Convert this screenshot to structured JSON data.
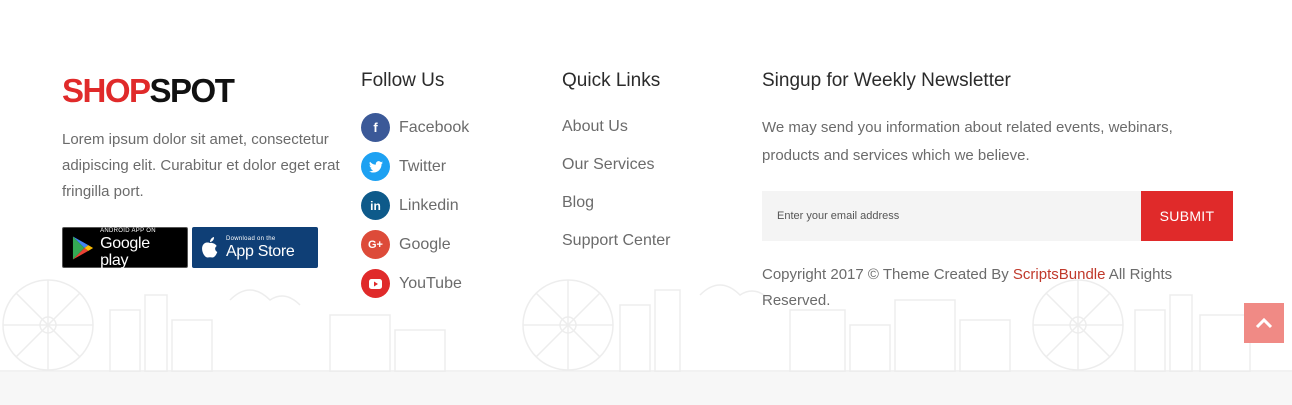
{
  "brand": {
    "logo_part1": "SHOP",
    "logo_part2": "SPOT",
    "about": "Lorem ipsum dolor sit amet, consectetur adipiscing elit. Curabitur et dolor eget erat fringilla port.",
    "stores": [
      {
        "small": "ANDROID APP ON",
        "big": "Google play",
        "icon": "google-play-icon"
      },
      {
        "small": "Download on the",
        "big": "App Store",
        "icon": "apple-icon"
      }
    ]
  },
  "follow": {
    "title": "Follow Us",
    "items": [
      {
        "label": "Facebook",
        "icon": "facebook-icon",
        "glyph": "f",
        "color": "#3b5998"
      },
      {
        "label": "Twitter",
        "icon": "twitter-icon",
        "glyph": "t",
        "color": "#1da1f2"
      },
      {
        "label": "Linkedin",
        "icon": "linkedin-icon",
        "glyph": "in",
        "color": "#0e5a8a"
      },
      {
        "label": "Google",
        "icon": "google-plus-icon",
        "glyph": "G+",
        "color": "#dd4b39"
      },
      {
        "label": "YouTube",
        "icon": "youtube-icon",
        "glyph": "▶",
        "color": "#e02a2a"
      }
    ]
  },
  "quick_links": {
    "title": "Quick Links",
    "items": [
      "About Us",
      "Our Services",
      "Blog",
      "Support Center"
    ]
  },
  "newsletter": {
    "title": "Singup for Weekly Newsletter",
    "description": "We may send you information about related events, webinars, products and services which we believe.",
    "email_placeholder": "Enter your email address",
    "submit_label": "SUBMIT"
  },
  "copyright": {
    "prefix": "Copyright 2017 © Theme Created By ",
    "brand": "ScriptsBundle",
    "suffix": " All Rights Reserved."
  },
  "colors": {
    "accent": "#e02a2a",
    "scroll_top": "#f08a85"
  },
  "scroll_top_icon": "chevron-up-icon"
}
